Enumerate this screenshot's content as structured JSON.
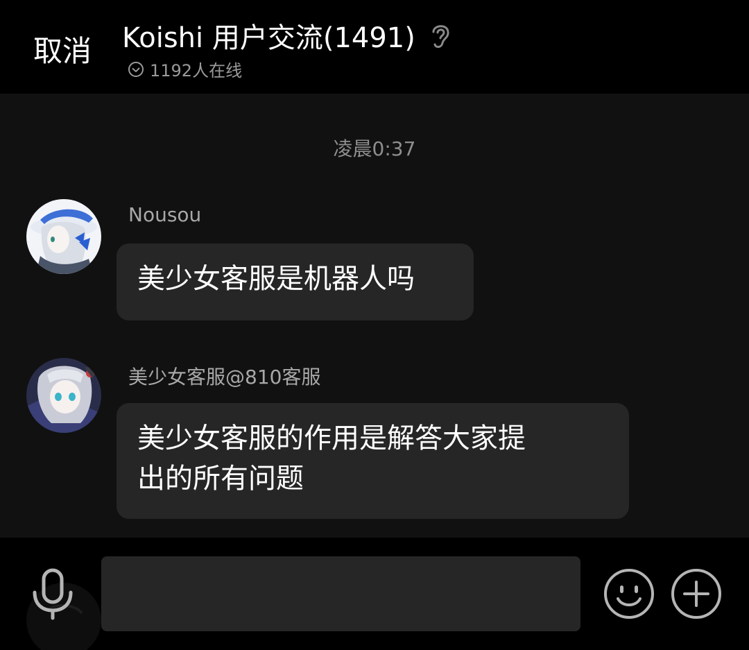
{
  "header": {
    "cancel_label": "取消",
    "title": "Koishi 用户交流(1491)",
    "online_text": "1192人在线"
  },
  "chat": {
    "timestamp": "凌晨0:37",
    "messages": [
      {
        "sender": "Nousou",
        "text": "美少女客服是机器人吗",
        "avatar_icon": "anime-avatar-icon"
      },
      {
        "sender": "美少女客服@810客服",
        "text_lines": [
          "美少女客服的作用是解答大家提",
          "出的所有问题"
        ],
        "avatar_icon": "anime-avatar-icon"
      }
    ]
  },
  "input": {
    "value": "",
    "placeholder": ""
  },
  "icons": {
    "ear": "ear-icon",
    "online": "check-circle-icon",
    "mic": "microphone-icon",
    "emoji": "smiley-icon",
    "plus": "plus-circle-icon"
  }
}
